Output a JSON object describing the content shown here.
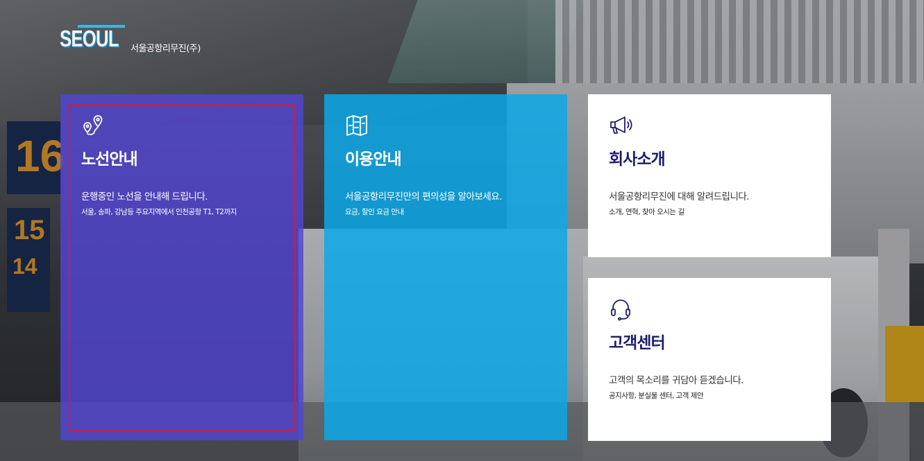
{
  "brand": {
    "logo_word": "SEOUL",
    "company_name": "서울공항리무진(주)",
    "accent_color": "#39b7e8"
  },
  "background_signs": [
    "16",
    "15",
    "14"
  ],
  "cards": {
    "route": {
      "icon": "route-pin-icon",
      "title": "노선안내",
      "description": "운행중인 노선을 안내해 드립니다.",
      "subtext": "서울, 송파, 강남등 주요지역에서 인천공항 T1, T2까지",
      "color": "#5246d2"
    },
    "guide": {
      "icon": "map-guide-icon",
      "title": "이용안내",
      "description": "서울공항리무진만의 편의성을 알아보세요.",
      "subtext": "요금, 할인 요금 안내",
      "color": "#0ca8e8"
    },
    "about": {
      "icon": "megaphone-icon",
      "title": "회사소개",
      "description": "서울공항리무진에 대해 알려드립니다.",
      "subtext": "소개, 연혁, 찾아 오시는 길",
      "color": "#ffffff"
    },
    "support": {
      "icon": "headset-icon",
      "title": "고객센터",
      "description": "고객의 목소리를 귀담아 듣겠습니다.",
      "subtext": "공지사항, 분실물 센터, 고객 제안",
      "color": "#ffffff"
    }
  },
  "focus_color": "#e0162d"
}
